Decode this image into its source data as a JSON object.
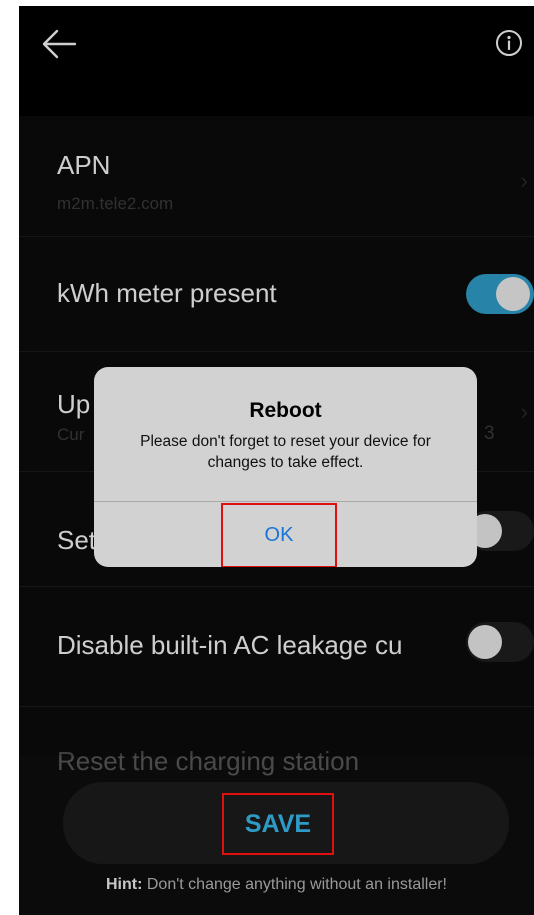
{
  "header": {
    "back_icon": "arrow-left-icon",
    "info_icon": "info-circle-icon"
  },
  "settings": {
    "apn": {
      "title": "APN",
      "value": "m2m.tele2.com"
    },
    "kwh_meter": {
      "title": "kWh meter present",
      "enabled": true
    },
    "update": {
      "title": "Up",
      "sub_prefix": "Cur",
      "sub_suffix": "3"
    },
    "set_row": {
      "title": "Set",
      "enabled": false
    },
    "disable_ac": {
      "title": "Disable built-in AC leakage cu",
      "enabled": false
    },
    "reset": {
      "title": "Reset the charging station"
    }
  },
  "save": {
    "label": "SAVE"
  },
  "hint": {
    "label": "Hint:",
    "text": " Don't change anything without an installer!"
  },
  "dialog": {
    "title": "Reboot",
    "message": "Please don't forget to reset your device for changes to take effect.",
    "ok_label": "OK"
  },
  "colors": {
    "accent": "#2e9bc6",
    "background": "#0b0b0b",
    "dialog": "#d2d2d2",
    "highlight": "#e01010"
  }
}
